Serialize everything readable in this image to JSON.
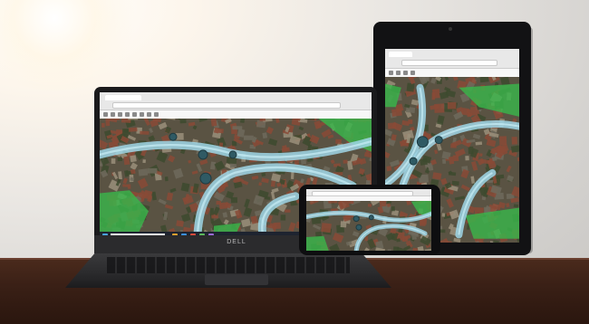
{
  "scene": {
    "devices": [
      "laptop",
      "tablet",
      "phone"
    ],
    "laptop_brand": "DELL"
  },
  "colors": {
    "road": "#9fd6e6",
    "road_center": "#c9eef6",
    "green_zone": "#39b54a",
    "aerial_base": "#5a5343",
    "roof": "#8a4a36",
    "desk": "#3a2016",
    "circle_marker": "#2f5a64"
  },
  "icons": [
    "browser-tab-icon",
    "map-zoom-icon",
    "taskbar-search-icon",
    "windows-start-icon"
  ]
}
